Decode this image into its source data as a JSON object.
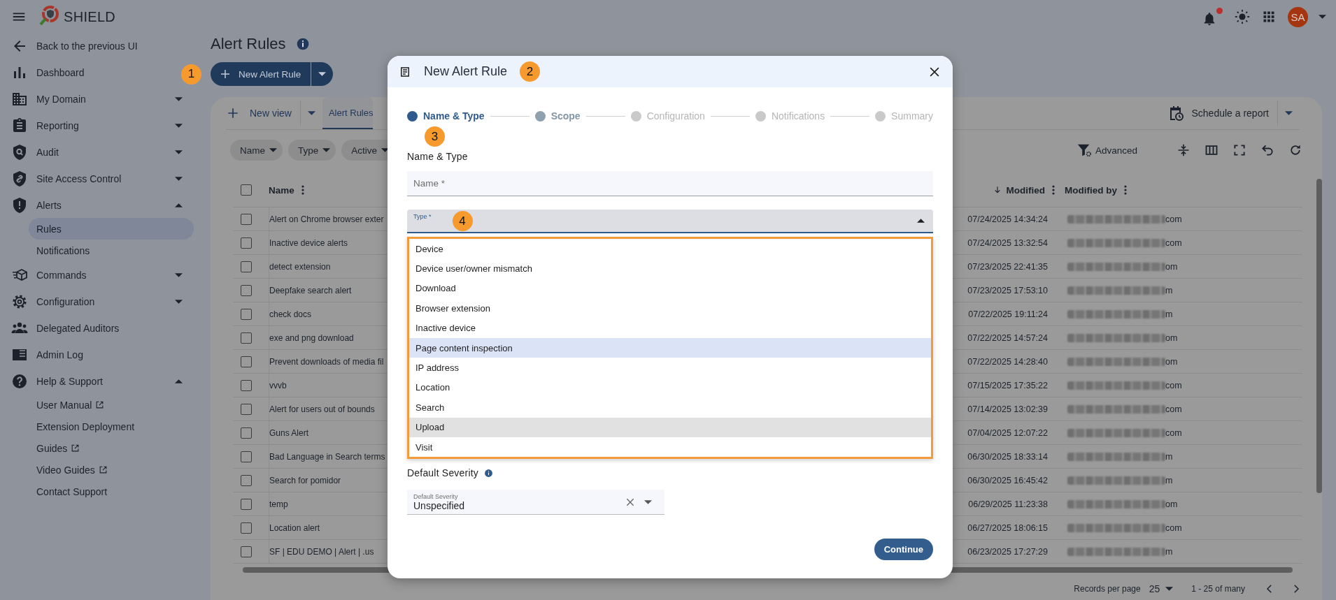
{
  "header": {
    "app_name": "SHIELD",
    "notifications_unread": true,
    "avatar_initials": "SA"
  },
  "sidebar": {
    "items": [
      {
        "label": "Back to the previous UI"
      },
      {
        "label": "Dashboard"
      },
      {
        "label": "My Domain",
        "expanded": false
      },
      {
        "label": "Reporting",
        "expanded": false
      },
      {
        "label": "Audit",
        "expanded": false
      },
      {
        "label": "Site Access Control",
        "expanded": false
      },
      {
        "label": "Alerts",
        "expanded": true,
        "children": [
          {
            "label": "Rules",
            "selected": true,
            "external": false
          },
          {
            "label": "Notifications",
            "selected": false,
            "external": false
          }
        ]
      },
      {
        "label": "Commands",
        "expanded": false
      },
      {
        "label": "Configuration",
        "expanded": false
      },
      {
        "label": "Delegated Auditors"
      },
      {
        "label": "Admin Log"
      },
      {
        "label": "Help & Support",
        "expanded": true,
        "children": [
          {
            "label": "User Manual",
            "selected": false,
            "external": true
          },
          {
            "label": "Extension Deployment",
            "selected": false,
            "external": false
          },
          {
            "label": "Guides",
            "selected": false,
            "external": true
          },
          {
            "label": "Video Guides",
            "selected": false,
            "external": true
          },
          {
            "label": "Contact Support",
            "selected": false,
            "external": false
          }
        ]
      }
    ]
  },
  "page": {
    "title": "Alert Rules",
    "new_button": "New Alert Rule",
    "new_view": "New view",
    "view_tabs": [
      {
        "label": "Alert Rules",
        "selected": true
      }
    ],
    "schedule_button": "Schedule a report",
    "filters": [
      "Name",
      "Type",
      "Active"
    ],
    "advanced": "Advanced",
    "table": {
      "select_all": {
        "checked": false
      },
      "columns": [
        {
          "label": "Name",
          "sorted": false
        },
        {
          "label": "Modified",
          "sorted": true
        },
        {
          "label": "Modified by",
          "sorted": false
        }
      ],
      "rows": [
        {
          "checked": false,
          "name": "Alert on Chrome browser exter",
          "modified": "07/24/2025 14:34:24",
          "modified_by": "com"
        },
        {
          "checked": false,
          "name": "Inactive device alerts",
          "modified": "07/24/2025 13:32:54",
          "modified_by": "com"
        },
        {
          "checked": false,
          "name": "detect extension",
          "modified": "07/23/2025 22:41:35",
          "modified_by": "om"
        },
        {
          "checked": false,
          "name": "Deepfake search alert",
          "modified": "07/23/2025 17:53:10",
          "modified_by": "m"
        },
        {
          "checked": false,
          "name": "check docs",
          "modified": "07/22/2025 19:11:24",
          "modified_by": "m"
        },
        {
          "checked": false,
          "name": "exe and png download",
          "modified": "07/22/2025 14:57:24",
          "modified_by": "om"
        },
        {
          "checked": false,
          "name": "Prevent downloads of media fil",
          "modified": "07/22/2025 14:28:40",
          "modified_by": "om"
        },
        {
          "checked": false,
          "name": "vvvb",
          "modified": "07/15/2025 17:35:22",
          "modified_by": "com"
        },
        {
          "checked": false,
          "name": "Alert for users out of bounds",
          "modified": "07/14/2025 13:02:39",
          "modified_by": "com"
        },
        {
          "checked": false,
          "name": "Guns Alert",
          "modified": "07/04/2025 12:07:22",
          "modified_by": "com"
        },
        {
          "checked": false,
          "name": "Bad Language in Search terms",
          "modified": "06/30/2025 18:33:14",
          "modified_by": "m"
        },
        {
          "checked": false,
          "name": "Search for pomidor",
          "modified": "06/30/2025 16:45:42",
          "modified_by": "m"
        },
        {
          "checked": false,
          "name": "temp",
          "modified": "06/29/2025 11:23:38",
          "modified_by": "om"
        },
        {
          "checked": false,
          "name": "Location alert",
          "modified": "06/27/2025 18:06:15",
          "modified_by": "com"
        },
        {
          "checked": false,
          "name": "SF | EDU DEMO | Alert | .us",
          "modified": "06/23/2025 17:27:29",
          "modified_by": "m"
        }
      ]
    },
    "pagination": {
      "rows_label": "Records per page",
      "page_size": "25",
      "range": "1 - 25 of many"
    }
  },
  "dialog": {
    "title": "New Alert Rule",
    "steps": [
      {
        "label": "Name & Type",
        "current": true,
        "enabled": true
      },
      {
        "label": "Scope",
        "current": false,
        "enabled": true
      },
      {
        "label": "Configuration",
        "current": false,
        "enabled": false
      },
      {
        "label": "Notifications",
        "current": false,
        "enabled": false
      },
      {
        "label": "Summary",
        "current": false,
        "enabled": false
      }
    ],
    "section_title": "Name & Type",
    "name_field": {
      "placeholder": "Name *"
    },
    "type_field": {
      "label": "Type *",
      "expanded": true,
      "options": [
        {
          "label": "Device",
          "selected": false,
          "hovered": false
        },
        {
          "label": "Device user/owner mismatch",
          "selected": false,
          "hovered": false
        },
        {
          "label": "Download",
          "selected": false,
          "hovered": false
        },
        {
          "label": "Browser extension",
          "selected": false,
          "hovered": false
        },
        {
          "label": "Inactive device",
          "selected": false,
          "hovered": false
        },
        {
          "label": "Page content inspection",
          "selected": true,
          "hovered": false
        },
        {
          "label": "IP address",
          "selected": false,
          "hovered": false
        },
        {
          "label": "Location",
          "selected": false,
          "hovered": false
        },
        {
          "label": "Search",
          "selected": false,
          "hovered": false
        },
        {
          "label": "Upload",
          "selected": false,
          "hovered": true
        },
        {
          "label": "Visit",
          "selected": false,
          "hovered": false
        }
      ]
    },
    "severity": {
      "title": "Default Severity",
      "field_label": "Default Severity",
      "value": "Unspecified"
    },
    "continue_button": "Continue"
  },
  "callouts": [
    "1",
    "2",
    "3",
    "4"
  ]
}
